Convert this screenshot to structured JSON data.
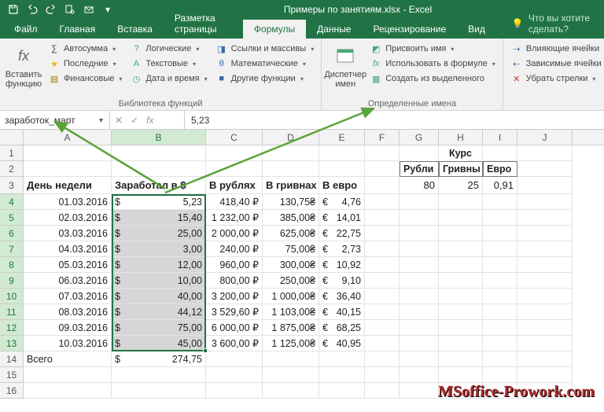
{
  "title": "Примеры по занятиям.xlsx - Excel",
  "tabs": {
    "file": "Файл",
    "home": "Главная",
    "insert": "Вставка",
    "layout": "Разметка страницы",
    "formulas": "Формулы",
    "data": "Данные",
    "review": "Рецензирование",
    "view": "Вид",
    "tellme": "Что вы хотите сделать?"
  },
  "ribbon": {
    "insert_fn": "Вставить функцию",
    "autosum": "Автосумма",
    "recent": "Последние",
    "financial": "Финансовые",
    "logical": "Логические",
    "text": "Текстовые",
    "date": "Дата и время",
    "lookup": "Ссылки и массивы",
    "math": "Математические",
    "more": "Другие функции",
    "lib_label": "Библиотека функций",
    "name_mgr": "Диспетчер имен",
    "define": "Присвоить имя",
    "use_in": "Использовать в формуле",
    "create": "Создать из выделенного",
    "names_label": "Определенные имена",
    "trace_prec": "Влияющие ячейки",
    "trace_dep": "Зависимые ячейки",
    "remove_arr": "Убрать стрелки"
  },
  "namebox": "заработок_март",
  "formula": "5,23",
  "cols": [
    "A",
    "B",
    "C",
    "D",
    "E",
    "F",
    "G",
    "H",
    "I",
    "J"
  ],
  "headers": {
    "day": "День недели",
    "earned": "Заработал в $",
    "rub": "В рублях",
    "uah": "В гривнах",
    "eur": "В евро",
    "kurs": "Курс",
    "rubli": "Рубли",
    "grivny": "Гривны",
    "evro": "Евро"
  },
  "rates": {
    "rub": "80",
    "uah": "25",
    "eur": "0,91"
  },
  "total_label": "Всего",
  "total_val": "274,75",
  "rows": [
    {
      "date": "01.03.2016",
      "usd": "5,23",
      "rub": "418,40 ₽",
      "uah": "130,75₴",
      "eur": "4,76"
    },
    {
      "date": "02.03.2016",
      "usd": "15,40",
      "rub": "1 232,00 ₽",
      "uah": "385,00₴",
      "eur": "14,01"
    },
    {
      "date": "03.03.2016",
      "usd": "25,00",
      "rub": "2 000,00 ₽",
      "uah": "625,00₴",
      "eur": "22,75"
    },
    {
      "date": "04.03.2016",
      "usd": "3,00",
      "rub": "240,00 ₽",
      "uah": "75,00₴",
      "eur": "2,73"
    },
    {
      "date": "05.03.2016",
      "usd": "12,00",
      "rub": "960,00 ₽",
      "uah": "300,00₴",
      "eur": "10,92"
    },
    {
      "date": "06.03.2016",
      "usd": "10,00",
      "rub": "800,00 ₽",
      "uah": "250,00₴",
      "eur": "9,10"
    },
    {
      "date": "07.03.2016",
      "usd": "40,00",
      "rub": "3 200,00 ₽",
      "uah": "1 000,00₴",
      "eur": "36,40"
    },
    {
      "date": "08.03.2016",
      "usd": "44,12",
      "rub": "3 529,60 ₽",
      "uah": "1 103,00₴",
      "eur": "40,15"
    },
    {
      "date": "09.03.2016",
      "usd": "75,00",
      "rub": "6 000,00 ₽",
      "uah": "1 875,00₴",
      "eur": "68,25"
    },
    {
      "date": "10.03.2016",
      "usd": "45,00",
      "rub": "3 600,00 ₽",
      "uah": "1 125,00₴",
      "eur": "40,95"
    }
  ],
  "watermark": "MSoffice-Prowork.com"
}
